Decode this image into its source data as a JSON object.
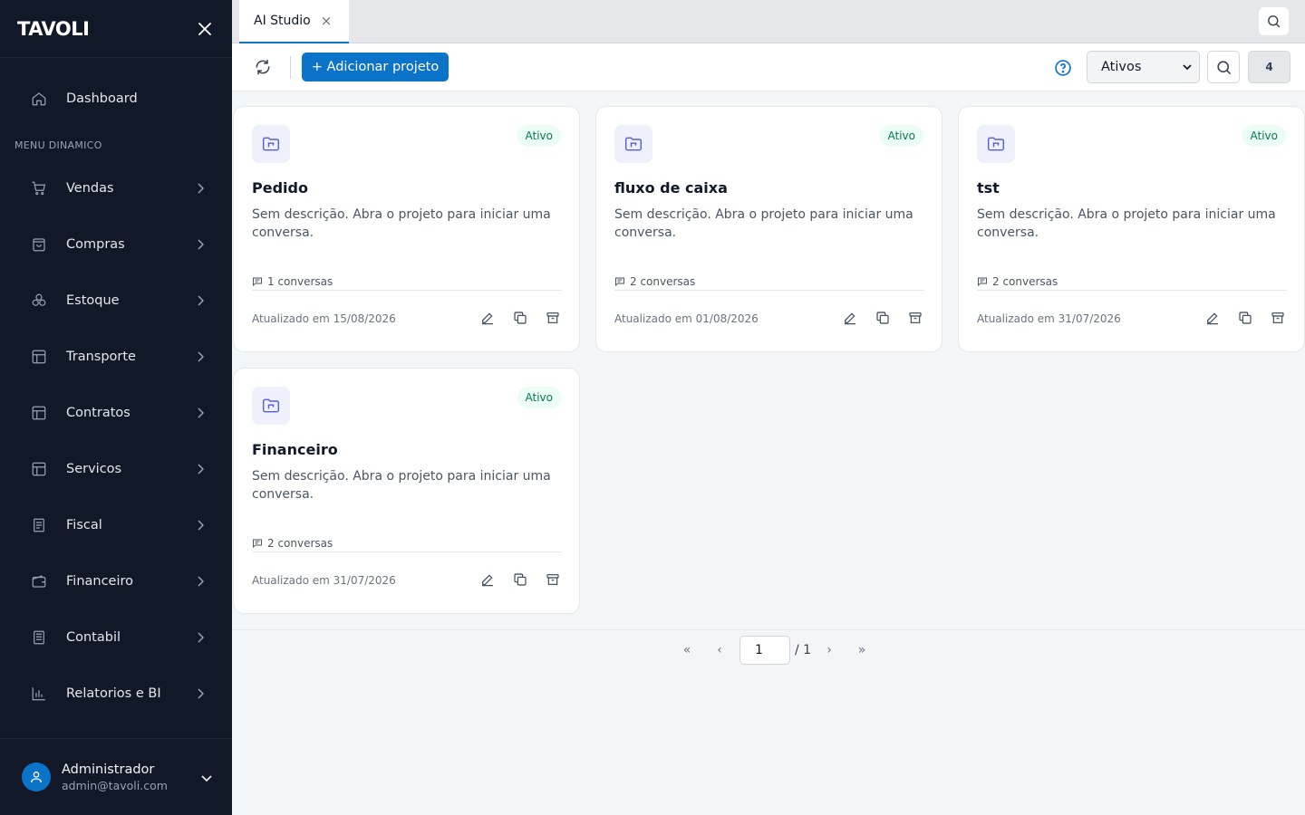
{
  "brand": {
    "logo": "TAVOLI"
  },
  "sidebar": {
    "dashboard": "Dashboard",
    "section_title": "MENU DINAMICO",
    "items": [
      {
        "label": "Vendas",
        "icon": "cart-icon"
      },
      {
        "label": "Compras",
        "icon": "bag-icon"
      },
      {
        "label": "Estoque",
        "icon": "boxes-icon"
      },
      {
        "label": "Transporte",
        "icon": "layout-icon"
      },
      {
        "label": "Contratos",
        "icon": "layout-icon"
      },
      {
        "label": "Servicos",
        "icon": "layout-icon"
      },
      {
        "label": "Fiscal",
        "icon": "receipt-icon"
      },
      {
        "label": "Financeiro",
        "icon": "wallet-icon"
      },
      {
        "label": "Contabil",
        "icon": "ledger-icon"
      },
      {
        "label": "Relatorios e BI",
        "icon": "bar-chart-icon"
      }
    ],
    "user": {
      "name": "Administrador",
      "email": "admin@tavoli.com"
    }
  },
  "tabs": [
    {
      "label": "AI Studio",
      "close": "×"
    }
  ],
  "toolbar": {
    "add_label": "+ Adicionar projeto",
    "filter_value": "Ativos",
    "count": "4"
  },
  "cards": [
    {
      "title": "Pedido",
      "badge": "Ativo",
      "description": "Sem descrição. Abra o projeto para iniciar uma conversa.",
      "conversations": "1 conversas",
      "updated": "Atualizado em 15/08/2026"
    },
    {
      "title": "fluxo de caixa",
      "badge": "Ativo",
      "description": "Sem descrição. Abra o projeto para iniciar uma conversa.",
      "conversations": "2 conversas",
      "updated": "Atualizado em 01/08/2026"
    },
    {
      "title": "tst",
      "badge": "Ativo",
      "description": "Sem descrição. Abra o projeto para iniciar uma conversa.",
      "conversations": "2 conversas",
      "updated": "Atualizado em 31/07/2026"
    },
    {
      "title": "Financeiro",
      "badge": "Ativo",
      "description": "Sem descrição. Abra o projeto para iniciar uma conversa.",
      "conversations": "2 conversas",
      "updated": "Atualizado em 31/07/2026"
    }
  ],
  "pagination": {
    "first": "«",
    "prev": "‹",
    "current": "1",
    "total": "/ 1",
    "next": "›",
    "last": "»"
  },
  "colors": {
    "primary": "#0b74c8",
    "sidebar_bg": "#111827",
    "badge_bg": "#ecfdf5",
    "badge_text": "#047857"
  }
}
